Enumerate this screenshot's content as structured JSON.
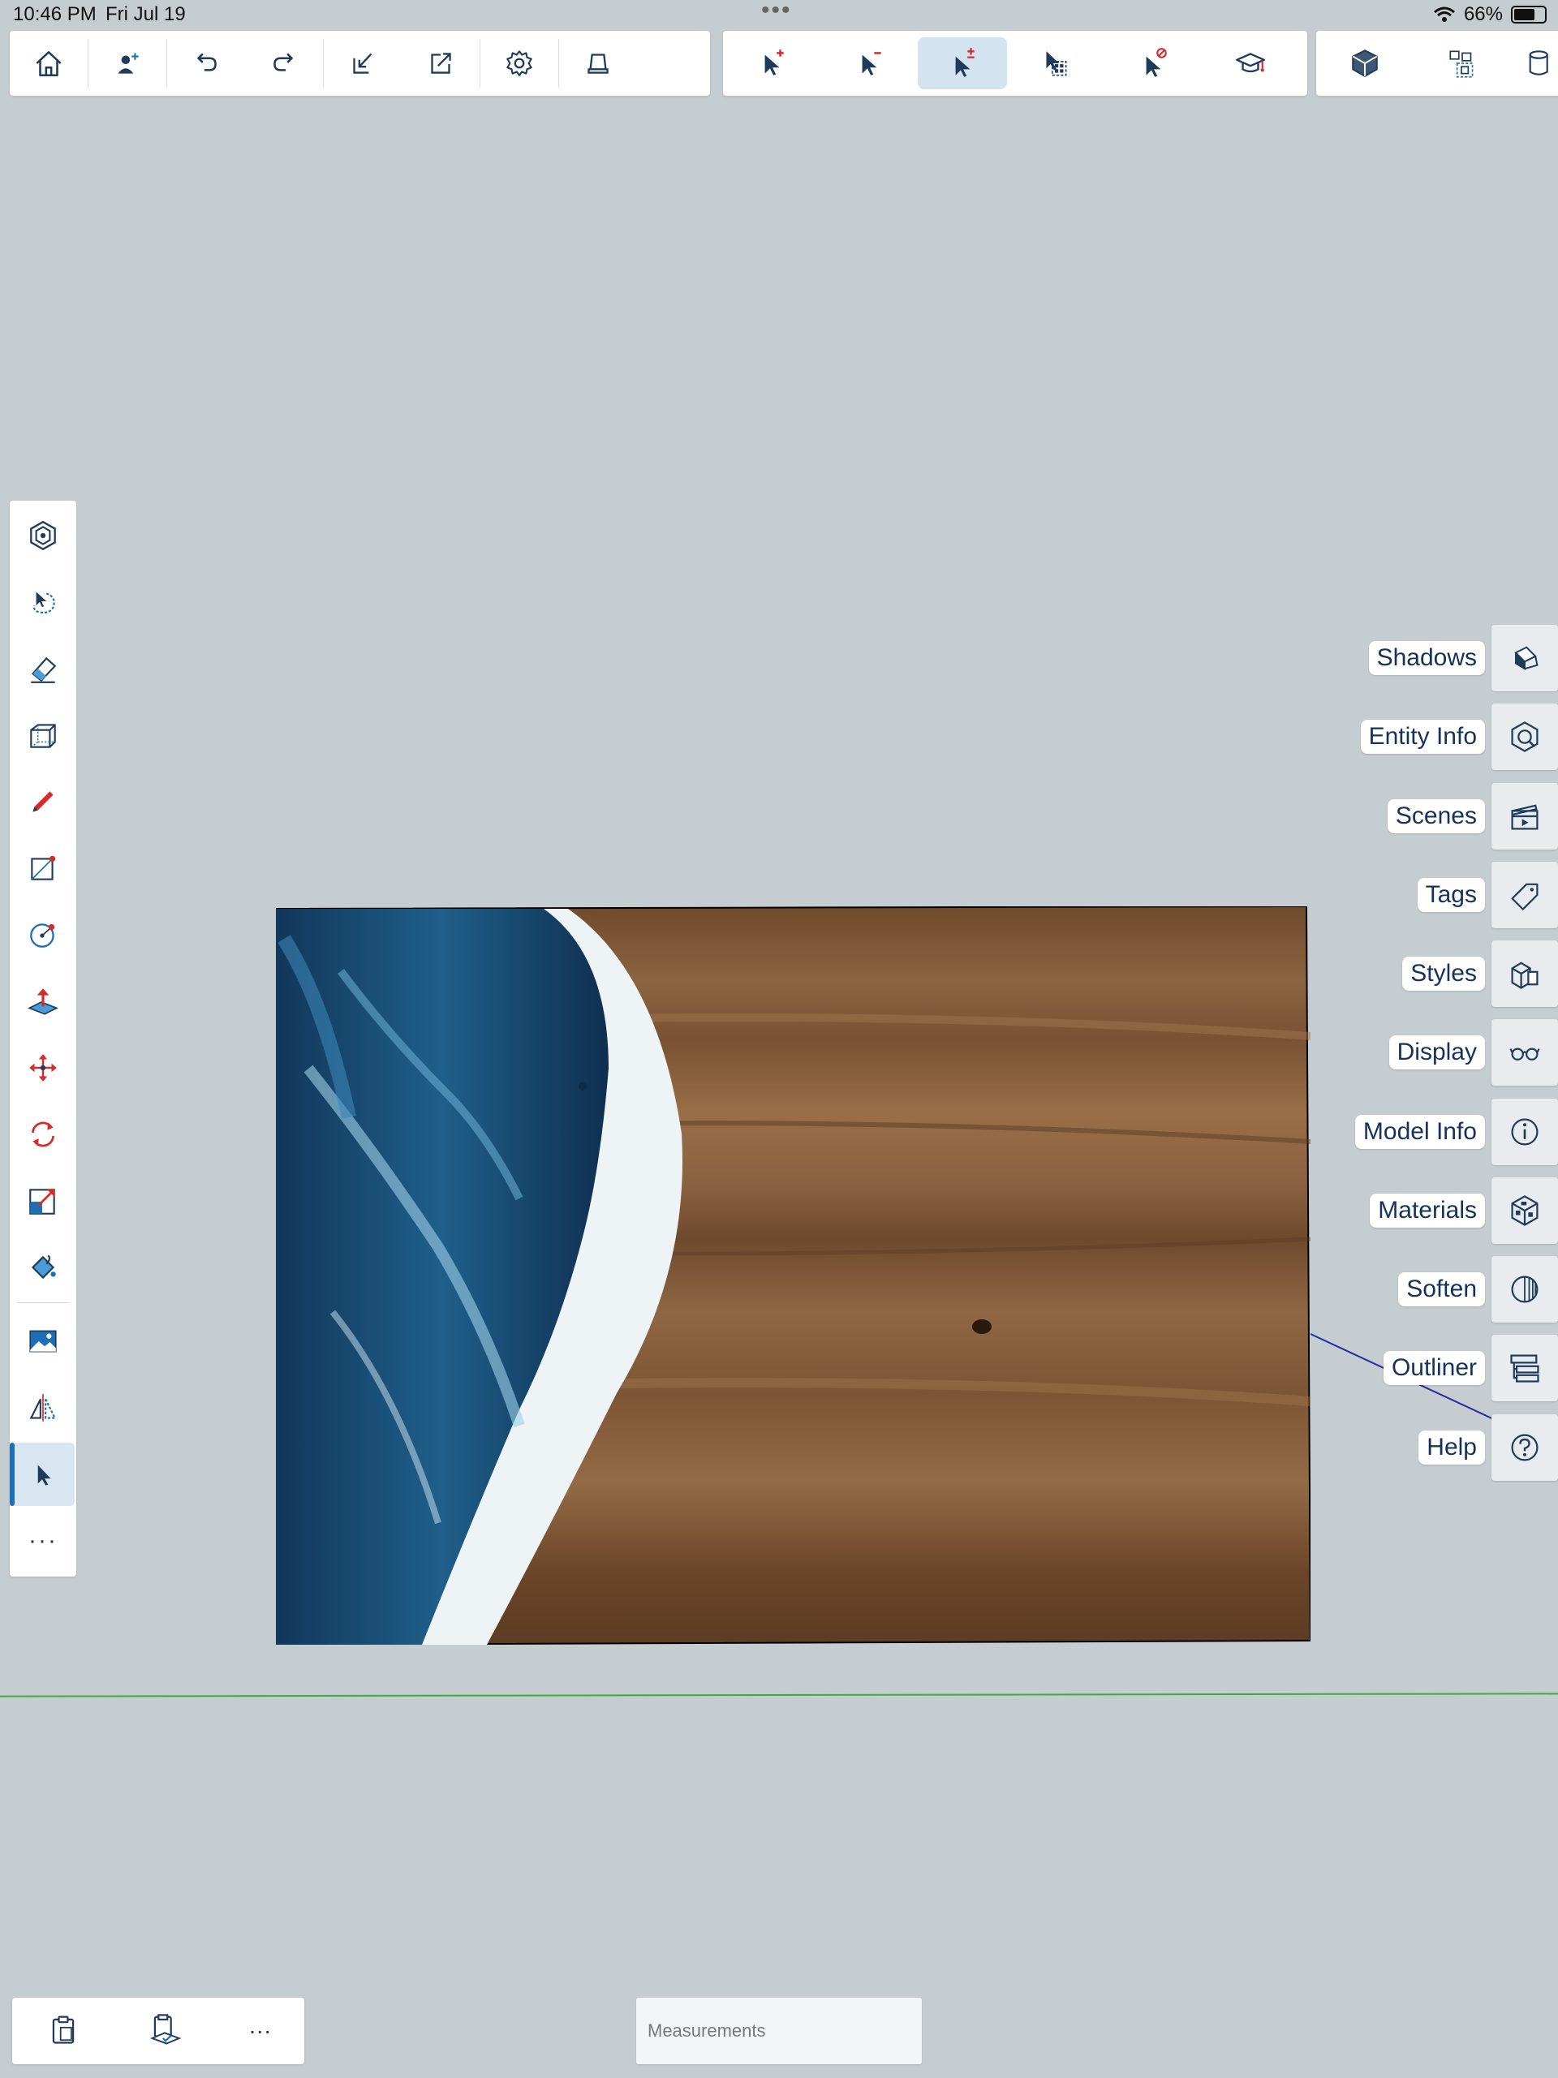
{
  "status_bar": {
    "time": "10:46 PM",
    "date": "Fri Jul 19",
    "battery": "66%"
  },
  "top_toolbar": {
    "group1": [
      "home-icon",
      "add-person-icon",
      "undo-icon",
      "redo-icon",
      "import-icon",
      "export-icon",
      "settings-icon",
      "view-icon"
    ],
    "group2": [
      "select-add-icon",
      "select-subtract-icon",
      "select-toggle-icon",
      "select-all-icon",
      "select-none-icon",
      "learn-icon"
    ],
    "group3": [
      "component-icon",
      "group-icon",
      "layers-icon"
    ]
  },
  "left_toolbar": [
    "orbit-tool",
    "lasso-select",
    "eraser",
    "push-pull-box",
    "pencil",
    "rectangle",
    "circle",
    "push-pull",
    "move",
    "rotate",
    "scale",
    "paint-bucket",
    "image",
    "mirror",
    "select",
    "more"
  ],
  "right_panel": [
    {
      "label": "Shadows",
      "icon": "shadows-icon"
    },
    {
      "label": "Entity Info",
      "icon": "entity-info-icon"
    },
    {
      "label": "Scenes",
      "icon": "scenes-icon"
    },
    {
      "label": "Tags",
      "icon": "tags-icon"
    },
    {
      "label": "Styles",
      "icon": "styles-icon"
    },
    {
      "label": "Display",
      "icon": "display-icon"
    },
    {
      "label": "Model Info",
      "icon": "model-info-icon"
    },
    {
      "label": "Materials",
      "icon": "materials-icon"
    },
    {
      "label": "Soften",
      "icon": "soften-icon"
    },
    {
      "label": "Outliner",
      "icon": "outliner-icon"
    },
    {
      "label": "Help",
      "icon": "help-icon"
    }
  ],
  "bottom_bar": {
    "more": "···"
  },
  "measurements": {
    "placeholder": "Measurements"
  },
  "colors": {
    "accent": "#1d6fb5",
    "background": "#c6cdd1",
    "green_axis": "#3dab3d",
    "blue_axis": "#2a2aa8"
  }
}
